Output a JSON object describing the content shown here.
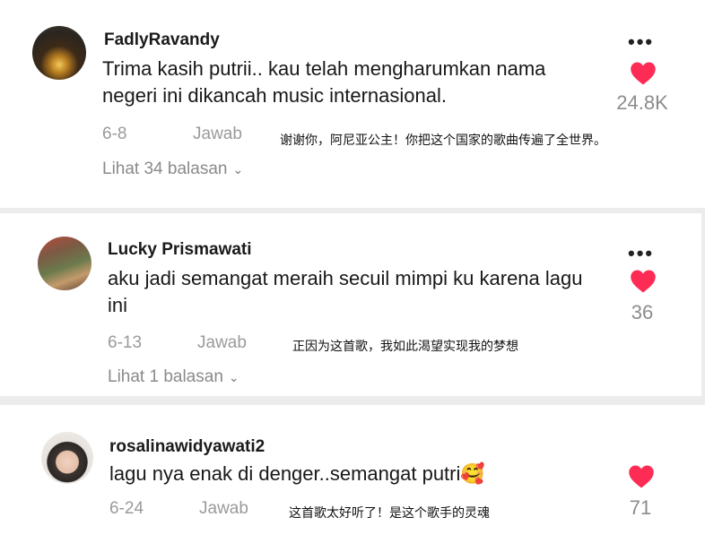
{
  "comments": [
    {
      "username": "FadlyRavandy",
      "text": "Trima kasih putrii.. kau telah mengharumkan nama negeri ini dikancah music internasional.",
      "date": "6-8",
      "reply_label": "Jawab",
      "translation": "谢谢你，阿尼亚公主！你把这个国家的歌曲传遍了全世界。",
      "view_replies": "Lihat 34 balasan",
      "likes": "24.8K",
      "heart_color": "#fe2c55"
    },
    {
      "username": "Lucky Prismawati",
      "text": "aku jadi semangat meraih secuil mimpi ku karena lagu ini",
      "date": "6-13",
      "reply_label": "Jawab",
      "translation": "正因为这首歌，我如此渴望实现我的梦想",
      "view_replies": "Lihat 1 balasan",
      "likes": "36",
      "heart_color": "#fe2c55"
    },
    {
      "username": "rosalinawidyawati2",
      "text": "lagu nya enak di denger..semangat putri",
      "emoji": "🥰",
      "date": "6-24",
      "reply_label": "Jawab",
      "translation": "这首歌太好听了！是这个歌手的灵魂",
      "likes": "71",
      "heart_color": "#fe2c55"
    }
  ],
  "icons": {
    "more": "more-options-icon",
    "like": "heart-icon",
    "expand": "chevron-down-icon"
  }
}
